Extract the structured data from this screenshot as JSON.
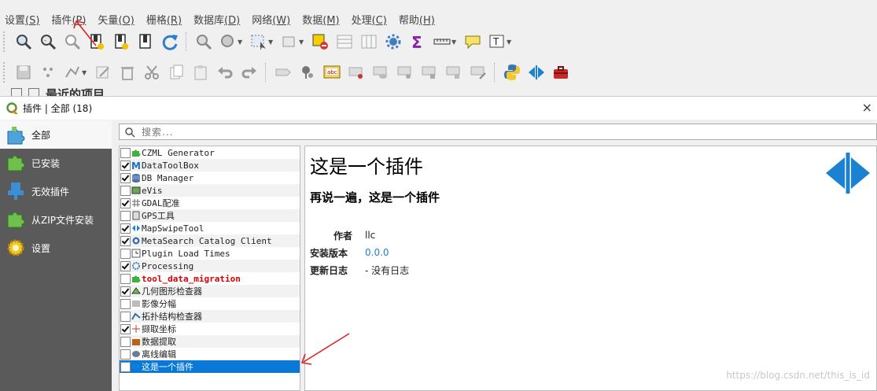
{
  "menubar": {
    "items": [
      {
        "label": "设置",
        "accel": "(S)"
      },
      {
        "label": "插件",
        "accel": "(P)"
      },
      {
        "label": "矢量",
        "accel": "(O)"
      },
      {
        "label": "栅格",
        "accel": "(R)"
      },
      {
        "label": "数据库",
        "accel": "(D)"
      },
      {
        "label": "网络",
        "accel": "(W)"
      },
      {
        "label": "数据",
        "accel": "(M)"
      },
      {
        "label": "处理",
        "accel": "(C)"
      },
      {
        "label": "帮助",
        "accel": "(H)"
      }
    ]
  },
  "background_panel": {
    "title": "最近的项目"
  },
  "dialog": {
    "title": "插件 | 全部 (18)",
    "close_glyph": "×",
    "search": {
      "placeholder": "搜索..."
    },
    "sidebar": [
      {
        "label": "全部",
        "icon": "puzzle-all-icon",
        "active": true
      },
      {
        "label": "已安装",
        "icon": "puzzle-installed-icon",
        "active": false
      },
      {
        "label": "无效插件",
        "icon": "invalid-plugin-icon",
        "active": false
      },
      {
        "label": "从ZIP文件安装",
        "icon": "zip-install-icon",
        "active": false
      },
      {
        "label": "设置",
        "icon": "settings-gear-icon",
        "active": false
      }
    ],
    "plugins": [
      {
        "name": "CZML Generator",
        "checked": false,
        "icon": "puzzle-icon"
      },
      {
        "name": "DataToolBox",
        "checked": true,
        "icon": "m-icon"
      },
      {
        "name": "DB Manager",
        "checked": true,
        "icon": "database-icon"
      },
      {
        "name": "eVis",
        "checked": false,
        "icon": "image-icon"
      },
      {
        "name": "GDAL配准",
        "checked": true,
        "icon": "grid-icon"
      },
      {
        "name": "GPS工具",
        "checked": false,
        "icon": "gps-icon"
      },
      {
        "name": "MapSwipeTool",
        "checked": true,
        "icon": "swipe-icon"
      },
      {
        "name": "MetaSearch Catalog Client",
        "checked": true,
        "icon": "catalog-icon"
      },
      {
        "name": "Plugin Load Times",
        "checked": false,
        "icon": "clock-icon"
      },
      {
        "name": "Processing",
        "checked": true,
        "icon": "gear-icon"
      },
      {
        "name": "tool_data_migration",
        "checked": false,
        "icon": "puzzle-icon",
        "highlight": true
      },
      {
        "name": "几何图形检查器",
        "checked": true,
        "icon": "geometry-icon"
      },
      {
        "name": "影像分幅",
        "checked": false,
        "icon": "raster-icon"
      },
      {
        "name": "拓扑结构检查器",
        "checked": false,
        "icon": "topology-icon"
      },
      {
        "name": "撷取坐标",
        "checked": true,
        "icon": "coordinate-icon"
      },
      {
        "name": "数据提取",
        "checked": false,
        "icon": "extract-icon"
      },
      {
        "name": "离线编辑",
        "checked": false,
        "icon": "offline-icon"
      },
      {
        "name": "这是一个插件",
        "checked": false,
        "icon": "swipe-icon",
        "selected": true
      }
    ],
    "details": {
      "title": "这是一个插件",
      "description": "再说一遍，这是一个插件",
      "author_label": "作者",
      "author": "llc",
      "version_label": "安装版本",
      "version": "0.0.0",
      "changelog_label": "更新日志",
      "changelog": "- 没有日志"
    }
  },
  "watermark": "https://blog.csdn.net/this_is_id",
  "colors": {
    "selection": "#0a78d7",
    "sidebar": "#5a5a5a",
    "link": "#1f7fd1",
    "highlight_text": "#d80000",
    "swipe_icon": "#1b82d1",
    "annotation_arrow": "#e02020"
  }
}
